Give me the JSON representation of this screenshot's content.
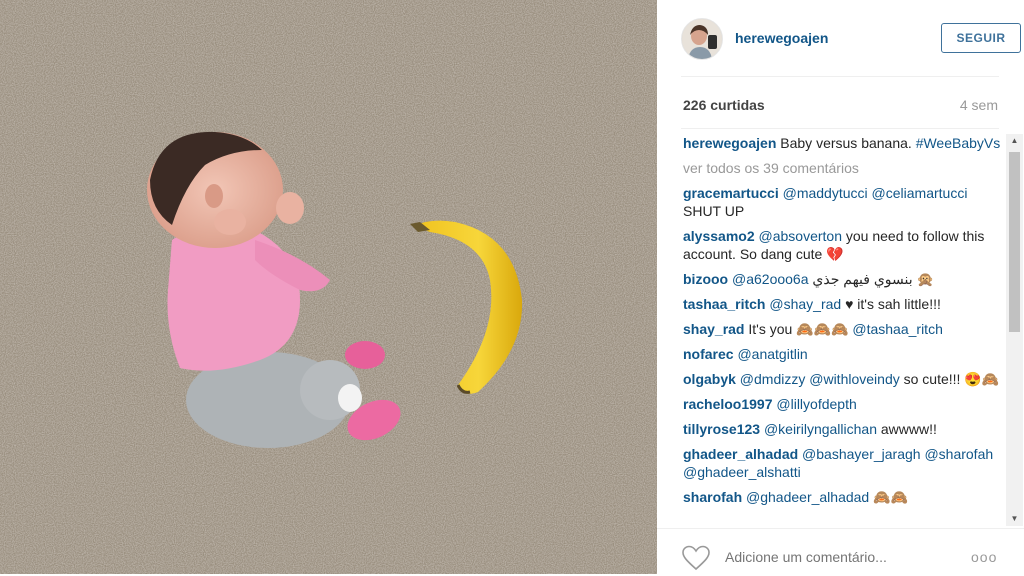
{
  "photo": {
    "alt": "Baby versus banana"
  },
  "header": {
    "username": "herewegoajen",
    "follow_label": "SEGUIR"
  },
  "stats": {
    "likes": "226 curtidas",
    "time": "4 sem"
  },
  "caption": {
    "user": "herewegoajen",
    "text": "Baby versus banana.",
    "hashtag": "#WeeBabyVs"
  },
  "view_all": "ver todos os 39 comentários",
  "comments": [
    {
      "user": "gracemartucci",
      "mention": "@maddytucci",
      "mention2": "@celiamartucci",
      "text": " SHUT UP"
    },
    {
      "user": "alyssamo2",
      "mention": "@absoverton",
      "text": " you need to follow this account. So dang cute 💔"
    },
    {
      "user": "bizooo",
      "mention": "@a62ooo6a",
      "text": " بنسوي فيهم جذي 🙊"
    },
    {
      "user": "tashaa_ritch",
      "mention": "@shay_rad",
      "text": " ♥ it's sah little!!!"
    },
    {
      "user": "shay_rad",
      "text": " It's you 🙈🙈🙈 ",
      "mention": "@tashaa_ritch"
    },
    {
      "user": "nofarec",
      "mention": "@anatgitlin"
    },
    {
      "user": "olgabyk",
      "mention": "@dmdizzy",
      "mention2": "@withloveindy",
      "text": " so cute!!! 😍🙈"
    },
    {
      "user": "racheloo1997",
      "mention": "@lillyofdepth"
    },
    {
      "user": "tillyrose123",
      "mention": "@keirilyngallichan",
      "text": " awwww!!"
    },
    {
      "user": "ghadeer_alhadad",
      "mention": "@bashayer_jaragh",
      "mention2": "@sharofah",
      "mention3": "@ghadeer_alshatti"
    },
    {
      "user": "sharofah",
      "mention": "@ghadeer_alhadad",
      "text": " 🙈🙈"
    }
  ],
  "footer": {
    "placeholder": "Adicione um comentário...",
    "more": "ooo"
  },
  "colors": {
    "link": "#125688",
    "follow": "#3f729b",
    "muted": "#999999",
    "carpet": "#8c8070"
  },
  "icons": {
    "like": "heart-icon",
    "options": "more-options-icon"
  }
}
